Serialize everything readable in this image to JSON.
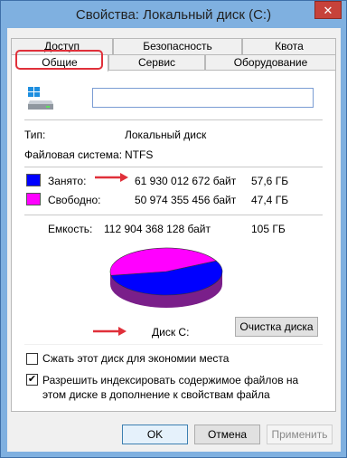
{
  "window": {
    "title": "Свойства: Локальный диск (C:)",
    "close_glyph": "✕"
  },
  "tabs": {
    "row1": [
      "Доступ",
      "Безопасность",
      "Квота"
    ],
    "row2": [
      "Общие",
      "Сервис",
      "Оборудование"
    ]
  },
  "general": {
    "name_value": "",
    "type_label": "Тип:",
    "type_value": "Локальный диск",
    "fs_label": "Файловая система:",
    "fs_value": "NTFS"
  },
  "usage": {
    "used_label": "Занято:",
    "used_bytes": "61 930 012 672 байт",
    "used_size": "57,6 ГБ",
    "free_label": "Свободно:",
    "free_bytes": "50 974 355 456 байт",
    "free_size": "47,4 ГБ",
    "capacity_label": "Емкость:",
    "capacity_bytes": "112 904 368 128 байт",
    "capacity_size": "105 ГБ",
    "used_color": "#0000ff",
    "free_color": "#ff00ff",
    "used_fraction": 0.5485
  },
  "disk_label": "Диск C:",
  "cleanup_button": "Очистка диска",
  "options": {
    "compress_label": "Сжать этот диск для экономии места",
    "compress_checked": false,
    "index_label": "Разрешить индексировать содержимое файлов на этом диске в дополнение к свойствам файла",
    "index_checked": true
  },
  "buttons": {
    "ok": "OK",
    "cancel": "Отмена",
    "apply": "Применить"
  },
  "annotations": {
    "highlight_color": "#e0303a"
  }
}
